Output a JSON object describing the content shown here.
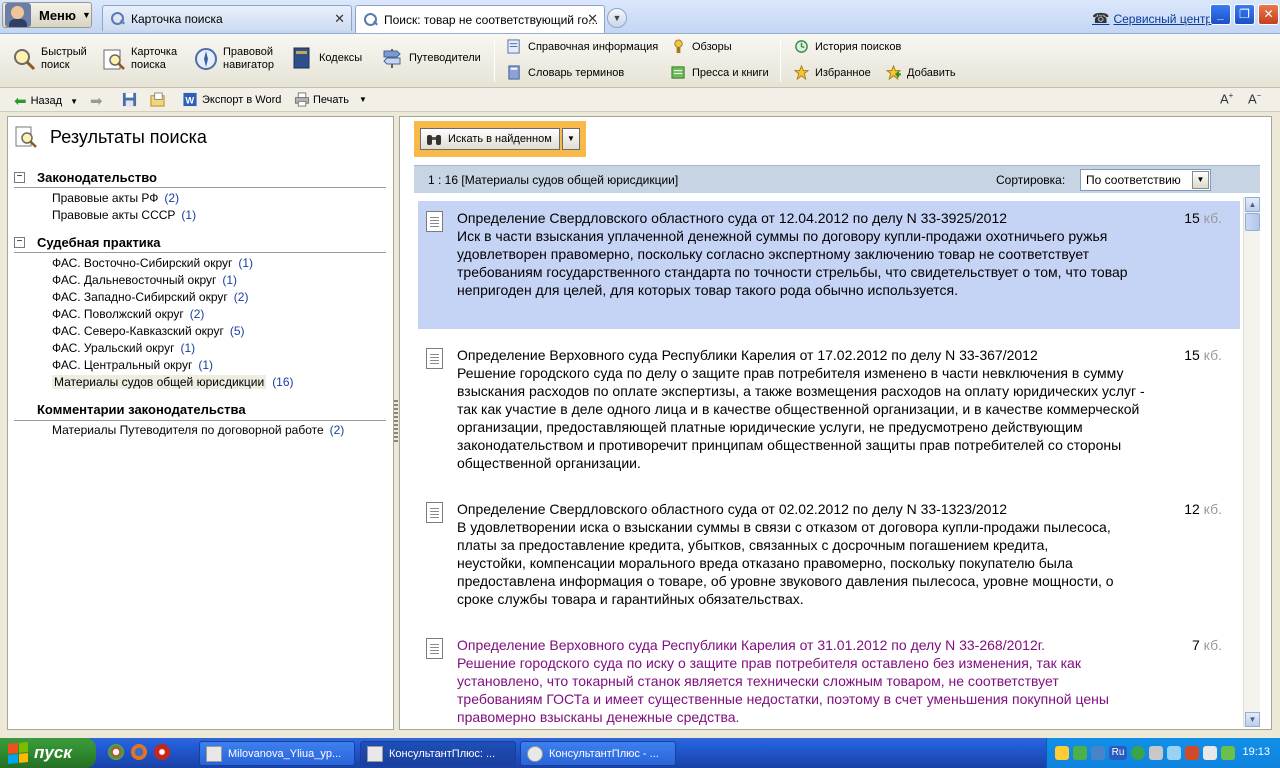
{
  "app": {
    "menu_label": "Меню",
    "service_center": "Сервисный центр"
  },
  "tabs": [
    {
      "label": "Карточка поиска",
      "active": false
    },
    {
      "label": "Поиск: товар не соответствующий го...",
      "active": true
    }
  ],
  "toolbar": {
    "quick_search": "Быстрый поиск",
    "search_card": "Карточка поиска",
    "legal_navigator": "Правовой навигатор",
    "codes": "Кодексы",
    "guides": "Путеводители",
    "reference_info": "Справочная информация",
    "reviews": "Обзоры",
    "terms_dictionary": "Словарь терминов",
    "press_books": "Пресса и книги",
    "search_history": "История поисков",
    "favorites": "Избранное",
    "add": "Добавить"
  },
  "subbar": {
    "back": "Назад",
    "export_word": "Экспорт в Word",
    "print": "Печать"
  },
  "left_panel": {
    "title": "Результаты поиска",
    "groups": [
      {
        "title": "Законодательство",
        "items": [
          {
            "label": "Правовые акты РФ",
            "count": "(2)"
          },
          {
            "label": "Правовые акты СССР",
            "count": "(1)"
          }
        ]
      },
      {
        "title": "Судебная практика",
        "items": [
          {
            "label": "ФАС. Восточно-Сибирский округ",
            "count": "(1)"
          },
          {
            "label": "ФАС. Дальневосточный округ",
            "count": "(1)"
          },
          {
            "label": "ФАС. Западно-Сибирский округ",
            "count": "(2)"
          },
          {
            "label": "ФАС. Поволжский округ",
            "count": "(2)"
          },
          {
            "label": "ФАС. Северо-Кавказский округ",
            "count": "(5)"
          },
          {
            "label": "ФАС. Уральский округ",
            "count": "(1)"
          },
          {
            "label": "ФАС. Центральный округ",
            "count": "(1)"
          },
          {
            "label": "Материалы судов общей юрисдикции",
            "count": "(16)",
            "selected": true
          }
        ]
      },
      {
        "title": "Комментарии законодательства",
        "items": [
          {
            "label": "Материалы Путеводителя по договорной работе",
            "count": "(2)"
          }
        ]
      }
    ]
  },
  "right_panel": {
    "search_in_found": "Искать в найденном",
    "result_count": "1 : 16 [Материалы судов общей юрисдикции]",
    "sort_label": "Сортировка:",
    "sort_value": "По соответствию",
    "kb_unit": "кб.",
    "documents": [
      {
        "title": "Определение Свердловского областного суда от 12.04.2012 по делу N 33-3925/2012",
        "body": "Иск в части взыскания уплаченной денежной суммы по договору купли-продажи охотничьего ружья удовлетворен правомерно, поскольку согласно экспертному заключению товар не соответствует требованиям государственного стандарта по точности стрельбы, что свидетельствует о том, что товар непригоден для целей, для которых товар такого рода обычно используется.",
        "size": "15"
      },
      {
        "title": "Определение Верховного суда Республики Карелия от 17.02.2012 по делу N 33-367/2012",
        "body": "Решение городского суда по делу о защите прав потребителя изменено в части невключения в сумму взыскания расходов по оплате экспертизы, а также возмещения расходов на оплату юридических услуг - так как участие в деле одного лица и в качестве общественной организации, и в качестве коммерческой организации, предоставляющей платные юридические услуги, не предусмотрено действующим законодательством и противоречит принципам общественной защиты прав потребителей со стороны общественной организации.",
        "size": "15"
      },
      {
        "title": "Определение Свердловского областного суда от 02.02.2012 по делу N 33-1323/2012",
        "body": "В удовлетворении иска о взыскании суммы в связи с отказом от договора купли-продажи пылесоса, платы за предоставление кредита, убытков, связанных с досрочным погашением кредита, неустойки, компенсации морального вреда отказано правомерно, поскольку покупателю была предоставлена информация о товаре, об уровне звукового давления пылесоса, уровне мощности, о сроке службы товара и гарантийных обязательствах.",
        "size": "12"
      },
      {
        "title": "Определение Верховного суда Республики Карелия от 31.01.2012 по делу N 33-268/2012г.",
        "body": "Решение городского суда по иску о защите прав потребителя оставлено без изменения, так как установлено, что токарный станок является технически сложным товаром, не соответствует требованиям ГОСТа и имеет существенные недостатки, поэтому в счет уменьшения покупной цены правомерно взысканы денежные средства.",
        "size": "7"
      }
    ]
  },
  "taskbar": {
    "start": "пуск",
    "tasks": [
      {
        "label": "Milovanova_Yliua_yp..."
      },
      {
        "label": "КонсультантПлюс: ..."
      },
      {
        "label": "КонсультантПлюс - ..."
      }
    ],
    "tray_lang": "Ru",
    "clock": "19:13"
  }
}
